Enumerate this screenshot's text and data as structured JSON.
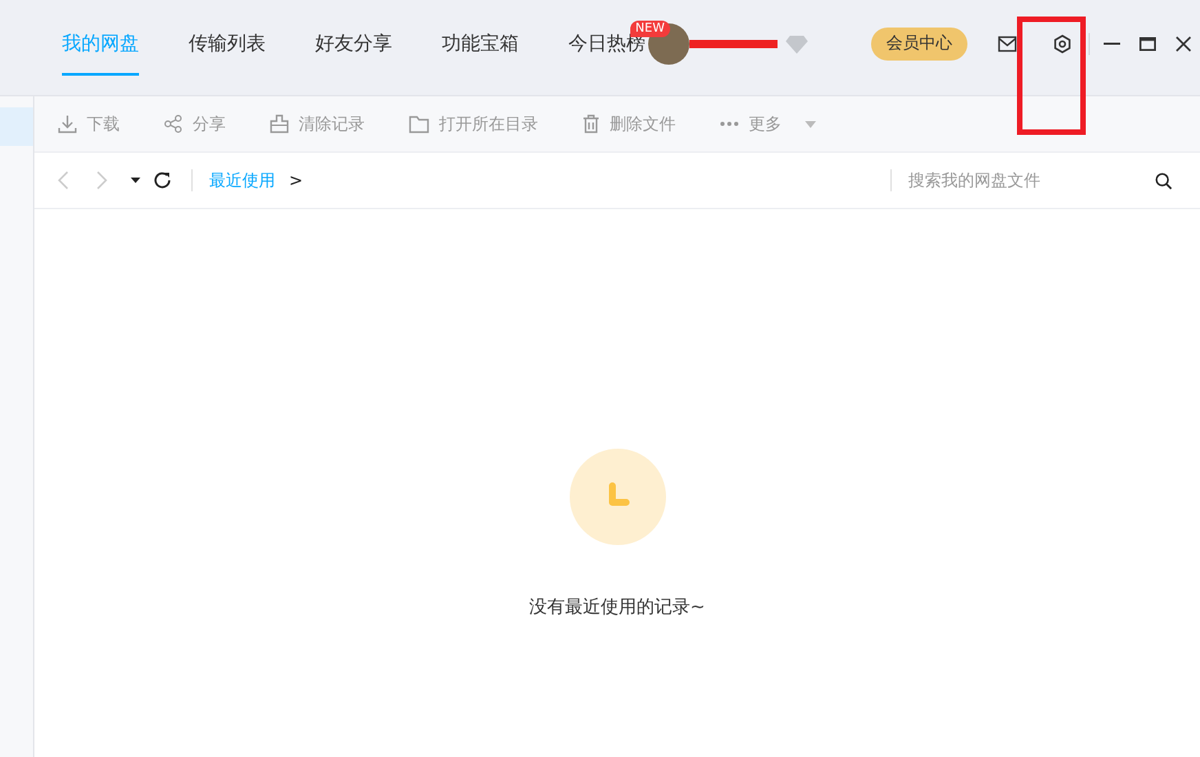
{
  "tabs": [
    {
      "label": "我的网盘",
      "selected": true
    },
    {
      "label": "传输列表",
      "selected": false
    },
    {
      "label": "好友分享",
      "selected": false
    },
    {
      "label": "功能宝箱",
      "selected": false
    },
    {
      "label": "今日热榜",
      "selected": false,
      "badge": "NEW"
    }
  ],
  "vip_button": "会员中心",
  "toolbar": [
    {
      "label": "下载",
      "kind": "download"
    },
    {
      "label": "分享",
      "kind": "share"
    },
    {
      "label": "清除记录",
      "kind": "clear"
    },
    {
      "label": "打开所在目录",
      "kind": "folder"
    },
    {
      "label": "删除文件",
      "kind": "delete"
    },
    {
      "label": "更多",
      "kind": "more"
    }
  ],
  "breadcrumb": [
    {
      "label": "最近使用"
    },
    {
      "label": ">"
    }
  ],
  "search": {
    "placeholder": "搜索我的网盘文件"
  },
  "empty_message": "没有最近使用的记录~"
}
